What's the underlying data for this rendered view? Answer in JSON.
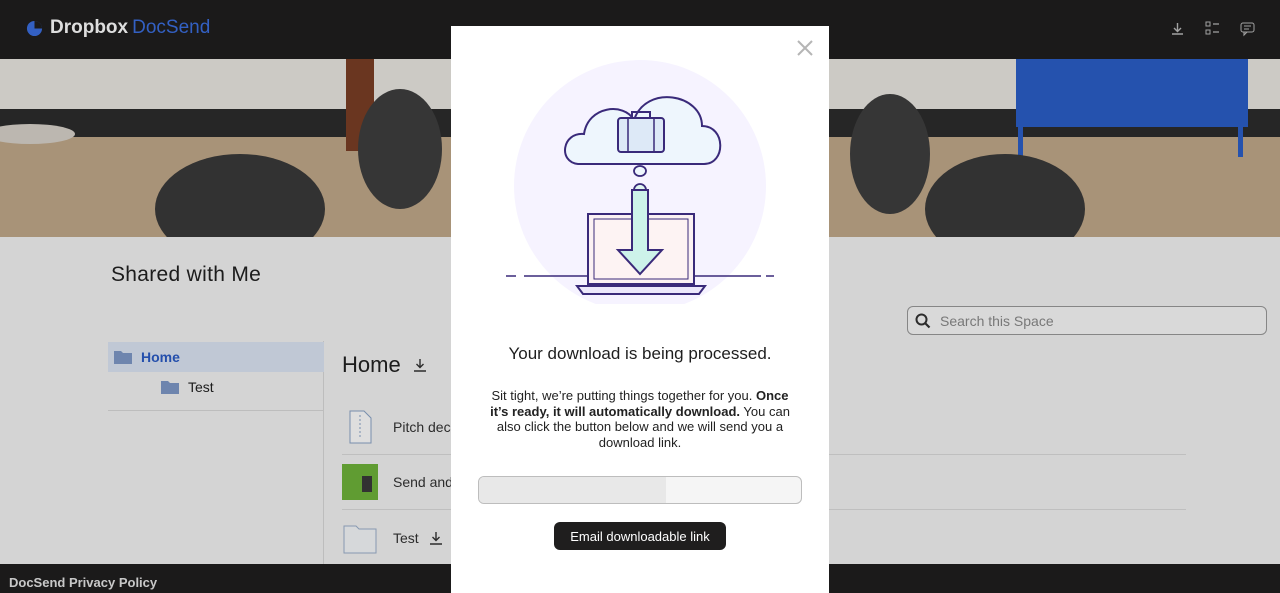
{
  "header": {
    "brand_primary": "Dropbox",
    "brand_secondary": "DocSend",
    "brand_color": "#3b6fe0",
    "icons": [
      "download-icon",
      "list-icon",
      "chat-icon"
    ]
  },
  "space": {
    "title": "Shared with Me",
    "search_placeholder": "Search this Space"
  },
  "sidebar": {
    "items": [
      {
        "label": "Home",
        "icon": "folder-icon",
        "selected": true
      },
      {
        "label": "Test",
        "icon": "folder-icon",
        "selected": false
      }
    ]
  },
  "main": {
    "title": "Home",
    "files": [
      {
        "label": "Pitch dec",
        "icon": "document-icon"
      },
      {
        "label": "Send and",
        "icon": "image-thumbnail"
      },
      {
        "label": "Test",
        "icon": "folder-icon"
      }
    ]
  },
  "modal": {
    "heading": "Your download is being processed.",
    "message_plain1": "Sit tight, we’re putting things together for you. ",
    "message_bold": "Once it’s ready, it will automatically download.",
    "message_plain2": " You can also click the button below and we will send you a download link.",
    "progress_percent": 58,
    "email_button": "Email downloadable link"
  },
  "footer": {
    "privacy_link": "DocSend Privacy Policy"
  }
}
